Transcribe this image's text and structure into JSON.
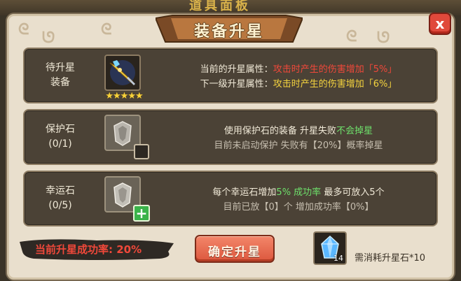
{
  "background": {
    "ghost_title": "道具面板"
  },
  "dialog": {
    "title": "装备升星",
    "close_label": "x"
  },
  "rows": {
    "equip": {
      "label_line1": "待升星",
      "label_line2": "装备",
      "stars": "★★★★★",
      "current_prefix": "当前的升星属性：",
      "current_value": "攻击时产生的伤害增加「5%」",
      "next_prefix": "下一级升星属性：",
      "next_value": "攻击时产生的伤害增加「6%」"
    },
    "protect": {
      "label_line1": "保护石",
      "label_line2": "(0/1)",
      "line1_prefix": "使用保护石的装备 升星失败",
      "line1_highlight": "不会掉星",
      "line2": "目前未启动保护 失败有【20%】概率掉星"
    },
    "luck": {
      "label_line1": "幸运石",
      "label_line2": "(0/5)",
      "line1_prefix": "每个幸运石增加",
      "line1_highlight": "5% 成功率",
      "line1_suffix": " 最多可放入5个",
      "line2": "目前已放【0】个 增加成功率【0%】",
      "add_label": "+"
    }
  },
  "footer": {
    "success_rate_text": "当前升星成功率: 20%",
    "confirm_label": "确定升星",
    "gem_count": "14",
    "cost_text": "需消耗升星石*10"
  },
  "colors": {
    "accent_red": "#f0483a",
    "accent_yellow": "#f4d33e",
    "accent_green": "#6ee06b",
    "panel_bg": "#e9dfcd",
    "row_bg": "#4b4236"
  },
  "icons": {
    "equip_item": "golden-spear-icon",
    "protect_stone": "protect-stone-icon",
    "luck_stone": "luck-stone-icon",
    "star_gem": "blue-crystal-icon"
  }
}
